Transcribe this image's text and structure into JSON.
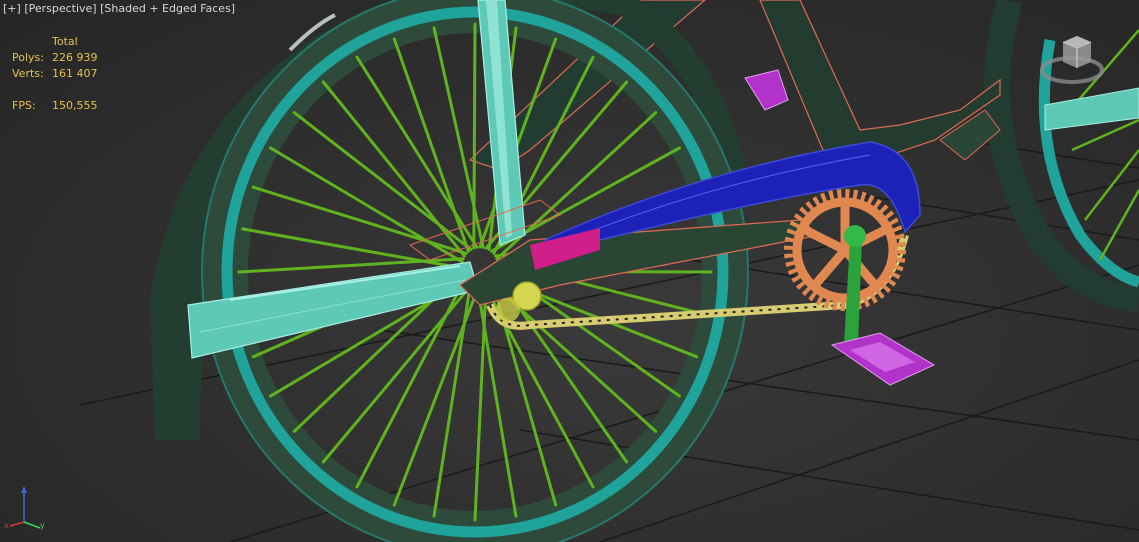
{
  "viewport": {
    "menu": {
      "plus_label": "[+]",
      "view_label": "[Perspective]",
      "shading_label": "[Shaded + Edged Faces]"
    },
    "stats": {
      "header": "Total",
      "polys_label": "Polys:",
      "polys_value": "226 939",
      "verts_label": "Verts:",
      "verts_value": "161 407",
      "fps_label": "FPS:",
      "fps_value": "150,555"
    }
  },
  "colors": {
    "background": "#2b2b2b",
    "grid": "#1a1a1a",
    "stats_text": "#e8c24a",
    "menu_text": "#d8d8d8",
    "tire": "#1fa39a",
    "spokes": "#5fb31e",
    "frame_wire": "#a8f0e4",
    "chain_guard": "#1c22b8",
    "chainring": "#e08850",
    "crank_arm": "#2aa33a",
    "pedal": "#b233c9",
    "chain": "#d8cc70",
    "hub": "#d4d650"
  }
}
